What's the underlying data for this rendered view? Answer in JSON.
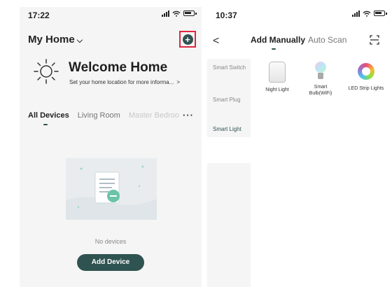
{
  "left_screen": {
    "status_time": "17:22",
    "home_title": "My Home",
    "add_icon": "plus-circle-icon",
    "welcome_title": "Welcome Home",
    "location_prompt": "Set your home location for more informa...",
    "location_arrow": ">",
    "tabs": [
      "All Devices",
      "Living Room",
      "Master Bedroo"
    ],
    "more_label": "···",
    "empty_text": "No devices",
    "add_device_label": "Add Device",
    "accent": "#2f5351",
    "highlight": "#e0263d"
  },
  "right_screen": {
    "status_time": "10:37",
    "back_label": "<",
    "tabs": [
      "Add Manually",
      "Auto Scan"
    ],
    "scan_icon": "scan-frame-icon",
    "categories": [
      "Smart Switch",
      "Smart Plug",
      "Smart Light"
    ],
    "selected_category": "Smart Light",
    "devices": [
      "Night Light",
      "Smart Bulb(WiFi)",
      "LED Strip Lights"
    ]
  }
}
